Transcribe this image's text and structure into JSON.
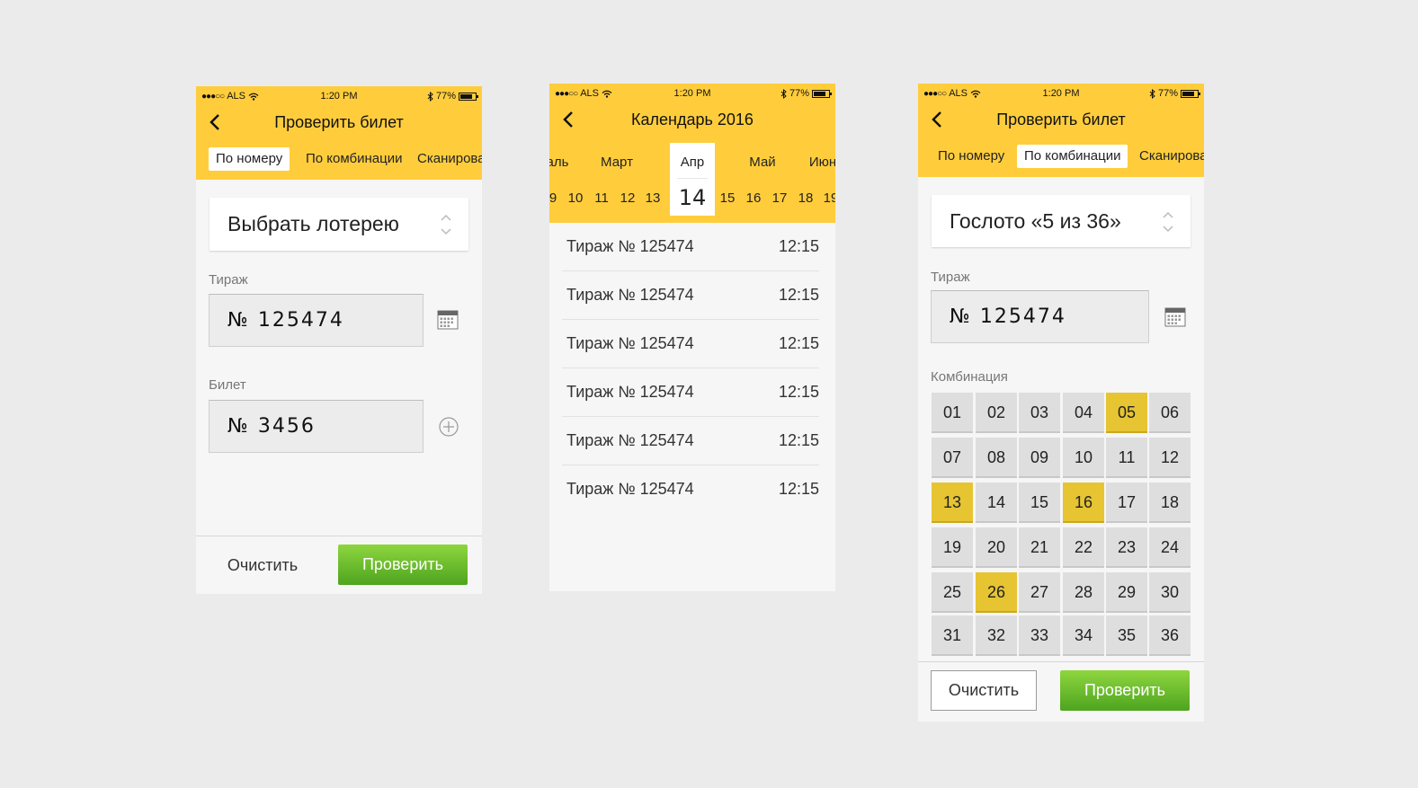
{
  "status": {
    "carrier": "ALS",
    "time": "1:20 PM",
    "battery": "77%"
  },
  "screen1": {
    "title": "Проверить билет",
    "tabs": [
      "По номеру",
      "По комбинации",
      "Сканирова"
    ],
    "select_placeholder": "Выбрать лотерею",
    "draw_label": "Тираж",
    "draw_value": "№ 125474",
    "ticket_label": "Билет",
    "ticket_value": "№ 3456",
    "clear_label": "Очистить",
    "check_label": "Проверить"
  },
  "screen2": {
    "title": "Календарь 2016",
    "months": [
      "аль",
      "Март",
      "Апр",
      "Май",
      "Июн"
    ],
    "days_left": [
      "9",
      "10",
      "11",
      "12",
      "13"
    ],
    "selected_day": "14",
    "days_right": [
      "15",
      "16",
      "17",
      "18",
      "19"
    ],
    "draws": [
      {
        "title": "Тираж № 125474",
        "time": "12:15"
      },
      {
        "title": "Тираж № 125474",
        "time": "12:15"
      },
      {
        "title": "Тираж № 125474",
        "time": "12:15"
      },
      {
        "title": "Тираж № 125474",
        "time": "12:15"
      },
      {
        "title": "Тираж № 125474",
        "time": "12:15"
      },
      {
        "title": "Тираж № 125474",
        "time": "12:15"
      }
    ]
  },
  "screen3": {
    "title": "Проверить билет",
    "tabs": [
      "По номеру",
      "По комбинации",
      "Сканирова"
    ],
    "lottery": "Гослото «5 из 36»",
    "draw_label": "Тираж",
    "draw_value": "№ 125474",
    "combo_label": "Комбинация",
    "numbers": [
      "01",
      "02",
      "03",
      "04",
      "05",
      "06",
      "07",
      "08",
      "09",
      "10",
      "11",
      "12",
      "13",
      "14",
      "15",
      "16",
      "17",
      "18",
      "19",
      "20",
      "21",
      "22",
      "23",
      "24",
      "25",
      "26",
      "27",
      "28",
      "29",
      "30",
      "31",
      "32",
      "33",
      "34",
      "35",
      "36"
    ],
    "selected_numbers": [
      "05",
      "13",
      "16",
      "26"
    ],
    "clear_label": "Очистить",
    "check_label": "Проверить"
  },
  "colors": {
    "header_yellow": "#ffcd3c",
    "selected_cell": "#e6c432",
    "check_green": "#6cc12e"
  },
  "icons": [
    "back-chevron-icon",
    "wifi-icon",
    "bluetooth-icon",
    "battery-icon",
    "calendar-icon",
    "plus-circle-icon",
    "up-down-arrows-icon"
  ]
}
